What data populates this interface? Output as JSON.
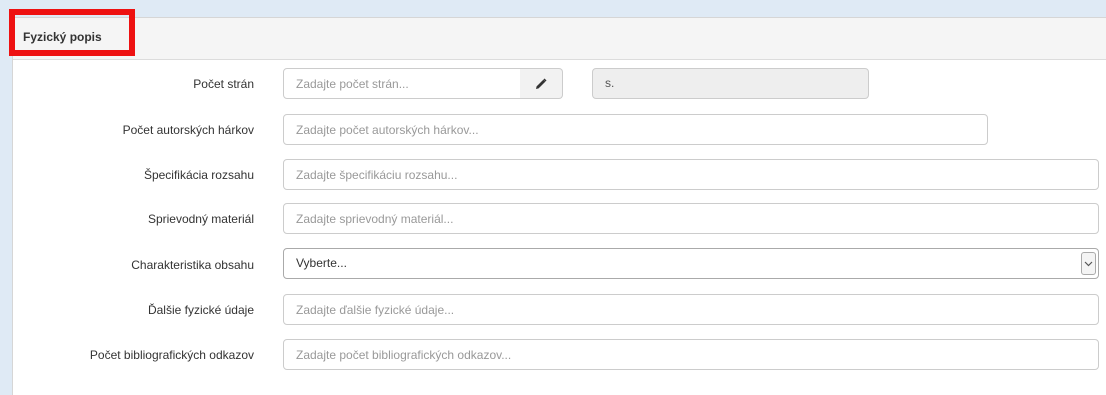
{
  "section": {
    "title": "Fyzický popis"
  },
  "fields": {
    "pocet_stran": {
      "label": "Počet strán",
      "placeholder": "Zadajte počet strán...",
      "suffix": "s."
    },
    "autorske_harky": {
      "label": "Počet autorských hárkov",
      "placeholder": "Zadajte počet autorských hárkov..."
    },
    "specifikacia": {
      "label": "Špecifikácia rozsahu",
      "placeholder": "Zadajte špecifikáciu rozsahu..."
    },
    "sprievodny": {
      "label": "Sprievodný materiál",
      "placeholder": "Zadajte sprievodný materiál..."
    },
    "charakteristika": {
      "label": "Charakteristika obsahu",
      "selected": "Vyberte..."
    },
    "dalsie": {
      "label": "Ďalšie fyzické údaje",
      "placeholder": "Zadajte ďalšie fyzické údaje..."
    },
    "bibliograficke": {
      "label": "Počet bibliografických odkazov",
      "placeholder": "Zadajte počet bibliografických odkazov..."
    }
  },
  "icons": {
    "edit": "pencil-icon",
    "dropdown": "chevron-down-icon"
  },
  "colors": {
    "highlight": "#ee1111"
  }
}
